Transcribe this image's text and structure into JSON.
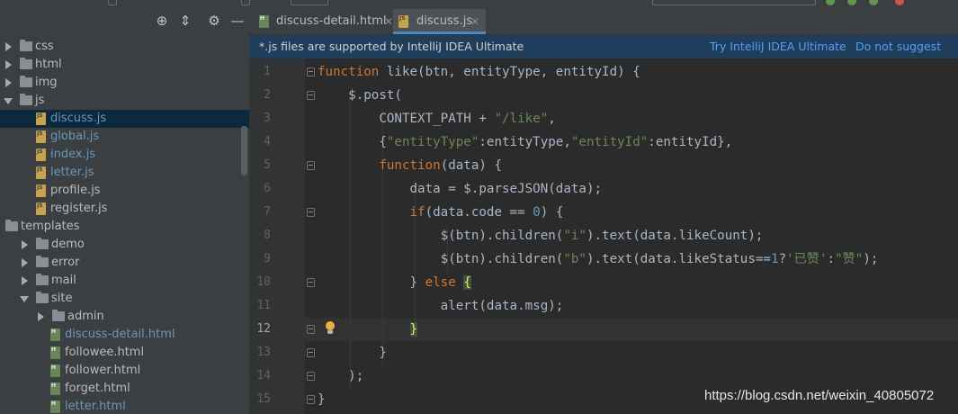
{
  "sidebar": {
    "toolbar_icons": [
      "target-icon",
      "collapse-icon",
      "gear-icon",
      "minimize-icon"
    ],
    "items": [
      {
        "label": "css",
        "type": "folder",
        "expanded": false
      },
      {
        "label": "html",
        "type": "folder",
        "expanded": false
      },
      {
        "label": "img",
        "type": "folder",
        "expanded": false
      },
      {
        "label": "js",
        "type": "folder",
        "expanded": true
      },
      {
        "label": "discuss.js",
        "type": "js",
        "selected": true
      },
      {
        "label": "global.js",
        "type": "js"
      },
      {
        "label": "index.js",
        "type": "js"
      },
      {
        "label": "letter.js",
        "type": "js"
      },
      {
        "label": "profile.js",
        "type": "js"
      },
      {
        "label": "register.js",
        "type": "js"
      },
      {
        "label": "templates",
        "type": "folder",
        "expanded": true
      },
      {
        "label": "demo",
        "type": "folder",
        "expanded": false
      },
      {
        "label": "error",
        "type": "folder",
        "expanded": false
      },
      {
        "label": "mail",
        "type": "folder",
        "expanded": false
      },
      {
        "label": "site",
        "type": "folder",
        "expanded": true
      },
      {
        "label": "admin",
        "type": "folder",
        "expanded": false
      },
      {
        "label": "discuss-detail.html",
        "type": "html"
      },
      {
        "label": "followee.html",
        "type": "html"
      },
      {
        "label": "follower.html",
        "type": "html"
      },
      {
        "label": "forget.html",
        "type": "html"
      },
      {
        "label": "letter.html",
        "type": "html"
      }
    ]
  },
  "tabs": [
    {
      "label": "discuss-detail.html",
      "icon": "html-file-icon",
      "active": false
    },
    {
      "label": "discuss.js",
      "icon": "js-file-icon",
      "active": true
    }
  ],
  "notice": {
    "message": "*.js files are supported by IntelliJ IDEA Ultimate",
    "try_link": "Try IntelliJ IDEA Ultimate",
    "dismiss_link": "Do not suggest Ulti"
  },
  "editor": {
    "current_line": 12,
    "line_numbers": [
      "1",
      "2",
      "3",
      "4",
      "5",
      "6",
      "7",
      "8",
      "9",
      "10",
      "11",
      "12",
      "13",
      "14",
      "15"
    ]
  },
  "watermark": "https://blog.csdn.net/weixin_40805072",
  "colors": {
    "keyword": "#cc7832",
    "string": "#6a8759",
    "number": "#6897bb",
    "text": "#a9b7c6",
    "notice_bg": "#1f3e5c",
    "link": "#589df6"
  }
}
